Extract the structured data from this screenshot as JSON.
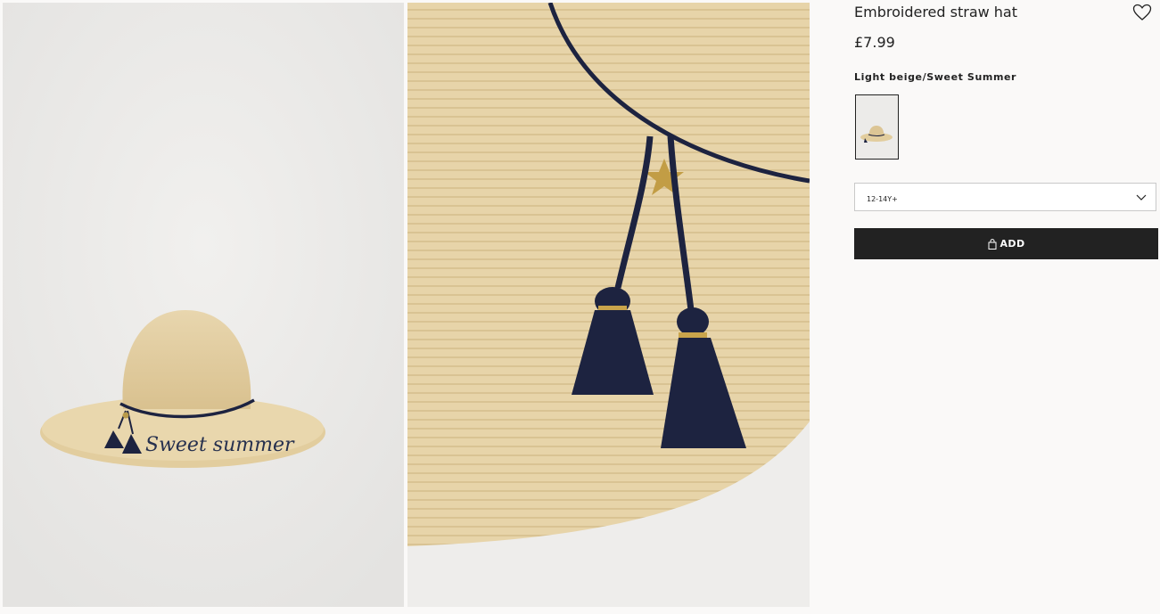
{
  "product": {
    "title": "Embroidered straw hat",
    "price": "£7.99",
    "color_name": "Light beige/Sweet Summer"
  },
  "size_select": {
    "selected": "12-14Y+"
  },
  "add_button": {
    "label": "ADD"
  },
  "images": {
    "main_embroidery_text": "Sweet summer"
  },
  "icons": {
    "favorite": "heart-icon",
    "dropdown": "chevron-down-icon",
    "bag": "shopping-bag-icon"
  },
  "colors": {
    "button_bg": "#222222",
    "straw": "#e6d3a7",
    "navy": "#1d2340",
    "background": "#faf9f8"
  }
}
